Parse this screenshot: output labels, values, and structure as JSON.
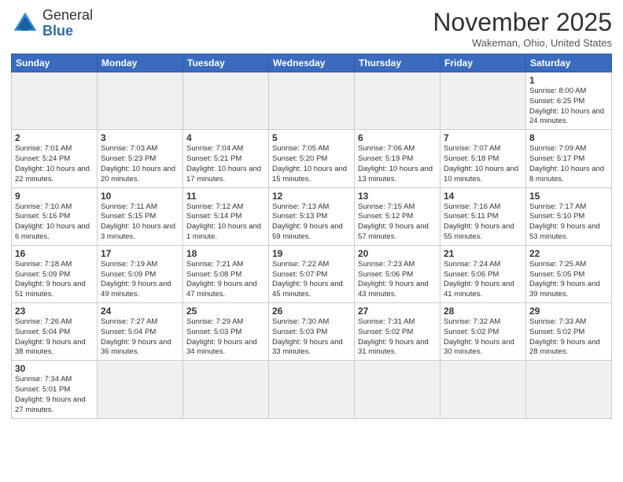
{
  "header": {
    "logo": {
      "general": "General",
      "blue": "Blue"
    },
    "title": "November 2025",
    "location": "Wakeman, Ohio, United States"
  },
  "calendar": {
    "days_of_week": [
      "Sunday",
      "Monday",
      "Tuesday",
      "Wednesday",
      "Thursday",
      "Friday",
      "Saturday"
    ],
    "weeks": [
      [
        {
          "day": "",
          "empty": true
        },
        {
          "day": "",
          "empty": true
        },
        {
          "day": "",
          "empty": true
        },
        {
          "day": "",
          "empty": true
        },
        {
          "day": "",
          "empty": true
        },
        {
          "day": "",
          "empty": true
        },
        {
          "day": "1",
          "sunrise": "8:00 AM",
          "sunset": "6:25 PM",
          "daylight": "10 hours and 24 minutes."
        }
      ],
      [
        {
          "day": "2",
          "sunrise": "7:01 AM",
          "sunset": "5:24 PM",
          "daylight": "10 hours and 22 minutes."
        },
        {
          "day": "3",
          "sunrise": "7:03 AM",
          "sunset": "5:23 PM",
          "daylight": "10 hours and 20 minutes."
        },
        {
          "day": "4",
          "sunrise": "7:04 AM",
          "sunset": "5:21 PM",
          "daylight": "10 hours and 17 minutes."
        },
        {
          "day": "5",
          "sunrise": "7:05 AM",
          "sunset": "5:20 PM",
          "daylight": "10 hours and 15 minutes."
        },
        {
          "day": "6",
          "sunrise": "7:06 AM",
          "sunset": "5:19 PM",
          "daylight": "10 hours and 13 minutes."
        },
        {
          "day": "7",
          "sunrise": "7:07 AM",
          "sunset": "5:18 PM",
          "daylight": "10 hours and 10 minutes."
        },
        {
          "day": "8",
          "sunrise": "7:09 AM",
          "sunset": "5:17 PM",
          "daylight": "10 hours and 8 minutes."
        }
      ],
      [
        {
          "day": "9",
          "sunrise": "7:10 AM",
          "sunset": "5:16 PM",
          "daylight": "10 hours and 6 minutes."
        },
        {
          "day": "10",
          "sunrise": "7:11 AM",
          "sunset": "5:15 PM",
          "daylight": "10 hours and 3 minutes."
        },
        {
          "day": "11",
          "sunrise": "7:12 AM",
          "sunset": "5:14 PM",
          "daylight": "10 hours and 1 minute."
        },
        {
          "day": "12",
          "sunrise": "7:13 AM",
          "sunset": "5:13 PM",
          "daylight": "9 hours and 59 minutes."
        },
        {
          "day": "13",
          "sunrise": "7:15 AM",
          "sunset": "5:12 PM",
          "daylight": "9 hours and 57 minutes."
        },
        {
          "day": "14",
          "sunrise": "7:16 AM",
          "sunset": "5:11 PM",
          "daylight": "9 hours and 55 minutes."
        },
        {
          "day": "15",
          "sunrise": "7:17 AM",
          "sunset": "5:10 PM",
          "daylight": "9 hours and 53 minutes."
        }
      ],
      [
        {
          "day": "16",
          "sunrise": "7:18 AM",
          "sunset": "5:09 PM",
          "daylight": "9 hours and 51 minutes."
        },
        {
          "day": "17",
          "sunrise": "7:19 AM",
          "sunset": "5:09 PM",
          "daylight": "9 hours and 49 minutes."
        },
        {
          "day": "18",
          "sunrise": "7:21 AM",
          "sunset": "5:08 PM",
          "daylight": "9 hours and 47 minutes."
        },
        {
          "day": "19",
          "sunrise": "7:22 AM",
          "sunset": "5:07 PM",
          "daylight": "9 hours and 45 minutes."
        },
        {
          "day": "20",
          "sunrise": "7:23 AM",
          "sunset": "5:06 PM",
          "daylight": "9 hours and 43 minutes."
        },
        {
          "day": "21",
          "sunrise": "7:24 AM",
          "sunset": "5:06 PM",
          "daylight": "9 hours and 41 minutes."
        },
        {
          "day": "22",
          "sunrise": "7:25 AM",
          "sunset": "5:05 PM",
          "daylight": "9 hours and 39 minutes."
        }
      ],
      [
        {
          "day": "23",
          "sunrise": "7:26 AM",
          "sunset": "5:04 PM",
          "daylight": "9 hours and 38 minutes."
        },
        {
          "day": "24",
          "sunrise": "7:27 AM",
          "sunset": "5:04 PM",
          "daylight": "9 hours and 36 minutes."
        },
        {
          "day": "25",
          "sunrise": "7:29 AM",
          "sunset": "5:03 PM",
          "daylight": "9 hours and 34 minutes."
        },
        {
          "day": "26",
          "sunrise": "7:30 AM",
          "sunset": "5:03 PM",
          "daylight": "9 hours and 33 minutes."
        },
        {
          "day": "27",
          "sunrise": "7:31 AM",
          "sunset": "5:02 PM",
          "daylight": "9 hours and 31 minutes."
        },
        {
          "day": "28",
          "sunrise": "7:32 AM",
          "sunset": "5:02 PM",
          "daylight": "9 hours and 30 minutes."
        },
        {
          "day": "29",
          "sunrise": "7:33 AM",
          "sunset": "5:02 PM",
          "daylight": "9 hours and 28 minutes."
        }
      ],
      [
        {
          "day": "30",
          "sunrise": "7:34 AM",
          "sunset": "5:01 PM",
          "daylight": "9 hours and 27 minutes."
        },
        {
          "day": "",
          "empty": true
        },
        {
          "day": "",
          "empty": true
        },
        {
          "day": "",
          "empty": true
        },
        {
          "day": "",
          "empty": true
        },
        {
          "day": "",
          "empty": true
        },
        {
          "day": "",
          "empty": true
        }
      ]
    ]
  }
}
